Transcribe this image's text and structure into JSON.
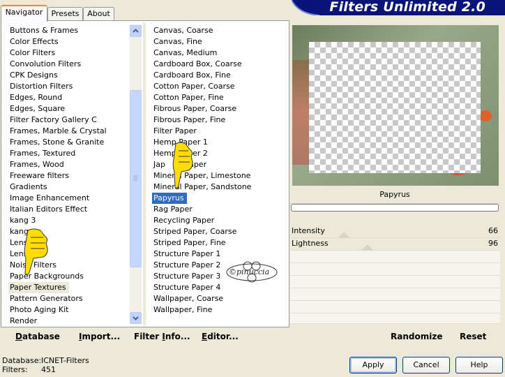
{
  "tabs": [
    {
      "label": "Navigator",
      "active": true
    },
    {
      "label": "Presets",
      "active": false
    },
    {
      "label": "About",
      "active": false
    }
  ],
  "app_title": "Filters Unlimited 2.0",
  "categories": [
    "Buttons & Frames",
    "Color Effects",
    "Color Filters",
    "Convolution Filters",
    "CPK Designs",
    "Distortion Filters",
    "Edges, Round",
    "Edges, Square",
    "Filter Factory Gallery C",
    "Frames, Marble & Crystal",
    "Frames, Stone & Granite",
    "Frames, Textured",
    "Frames, Wood",
    "Freeware filters",
    "Gradients",
    "Image Enhancement",
    "Italian Editors Effect",
    "kang 3",
    "kang 4",
    "Lens Effects",
    "Lens Flares",
    "Noise Filters",
    "Paper Backgrounds",
    "Paper Textures",
    "Pattern Generators",
    "Photo Aging Kit",
    "Render"
  ],
  "categories_visible": [
    "Buttons & Frames",
    "Color Effects",
    "Color Filters",
    "Convolution Filters",
    "CPK Designs",
    "Distortion Filters",
    "Edges, Round",
    "Edges, Square",
    "Filter Factory Gallery C",
    "Frames, Marble & Crystal",
    "Frames, Stone & Granite",
    "Frames, Textured",
    "Frames, Wood",
    "Freeware filters",
    "Gradients",
    "Image Enhancement",
    "Italian Editors Effect",
    "kang 3",
    "kang",
    "Lens",
    "Lens",
    "Noise Filters",
    "Paper Backgrounds",
    "Paper Textures",
    "Pattern Generators",
    "Photo Aging Kit",
    "Render"
  ],
  "selected_category": "Paper Textures",
  "filters": [
    "Canvas, Coarse",
    "Canvas, Fine",
    "Canvas, Medium",
    "Cardboard Box, Coarse",
    "Cardboard Box, Fine",
    "Cotton Paper, Coarse",
    "Cotton Paper, Fine",
    "Fibrous Paper, Coarse",
    "Fibrous Paper, Fine",
    "Filter Paper",
    "Hemp Paper 1",
    "Hemp Paper 2",
    "Japanese Paper",
    "Mineral Paper, Limestone",
    "Mineral Paper, Sandstone",
    "Papyrus",
    "Rag Paper",
    "Recycling Paper",
    "Striped Paper, Coarse",
    "Striped Paper, Fine",
    "Structure Paper 1",
    "Structure Paper 2",
    "Structure Paper 3",
    "Structure Paper 4",
    "Wallpaper, Coarse",
    "Wallpaper, Fine"
  ],
  "filters_visible": [
    "Canvas, Coarse",
    "Canvas, Fine",
    "Canvas, Medium",
    "Cardboard Box, Coarse",
    "Cardboard Box, Fine",
    "Cotton Paper, Coarse",
    "Cotton Paper, Fine",
    "Fibrous Paper, Coarse",
    "Fibrous Paper, Fine",
    "Filter Paper",
    "Hemp Paper 1",
    "Hemp Paper 2",
    "Jap        Paper",
    "Mineral Paper, Limestone",
    "Mineral Paper, Sandstone",
    "Papyrus",
    "Rag Paper",
    "Recycling Paper",
    "Striped Paper, Coarse",
    "Striped Paper, Fine",
    "Structure Paper 1",
    "Structure Paper 2",
    "Structure Paper 3",
    "Structure Paper 4",
    "Wallpaper, Coarse",
    "Wallpaper, Fine"
  ],
  "selected_filter": "Papyrus",
  "watermark": "©pinuccia",
  "bottom_links": {
    "database": {
      "underline": "D",
      "rest": "atabase"
    },
    "import": {
      "underline": "I",
      "rest": "mport..."
    },
    "filter_info": {
      "pre": "Filter ",
      "underline": "I",
      "rest": "nfo..."
    },
    "editor": {
      "underline": "E",
      "rest": "ditor..."
    }
  },
  "current_filter_name": "Papyrus",
  "sliders": [
    {
      "label": "Intensity",
      "value": "66",
      "level": 66
    },
    {
      "label": "Lightness",
      "value": "96",
      "level": 96
    }
  ],
  "randomize_label": "Randomize",
  "reset_label": "Reset",
  "footer": {
    "database_label": "Database:",
    "database_value": "ICNET-Filters",
    "filters_label": "Filters:",
    "filters_value": "451"
  },
  "buttons": {
    "apply": "Apply",
    "cancel": "Cancel",
    "help": "Help"
  },
  "icons": {
    "scroll_up": "chevron-up-icon",
    "scroll_down": "chevron-down-icon",
    "pointer": "pointing-hand-icon"
  },
  "colors": {
    "selection": "#316ac5",
    "banner": "#0a1478",
    "tab_accent": "#e68b2c"
  }
}
